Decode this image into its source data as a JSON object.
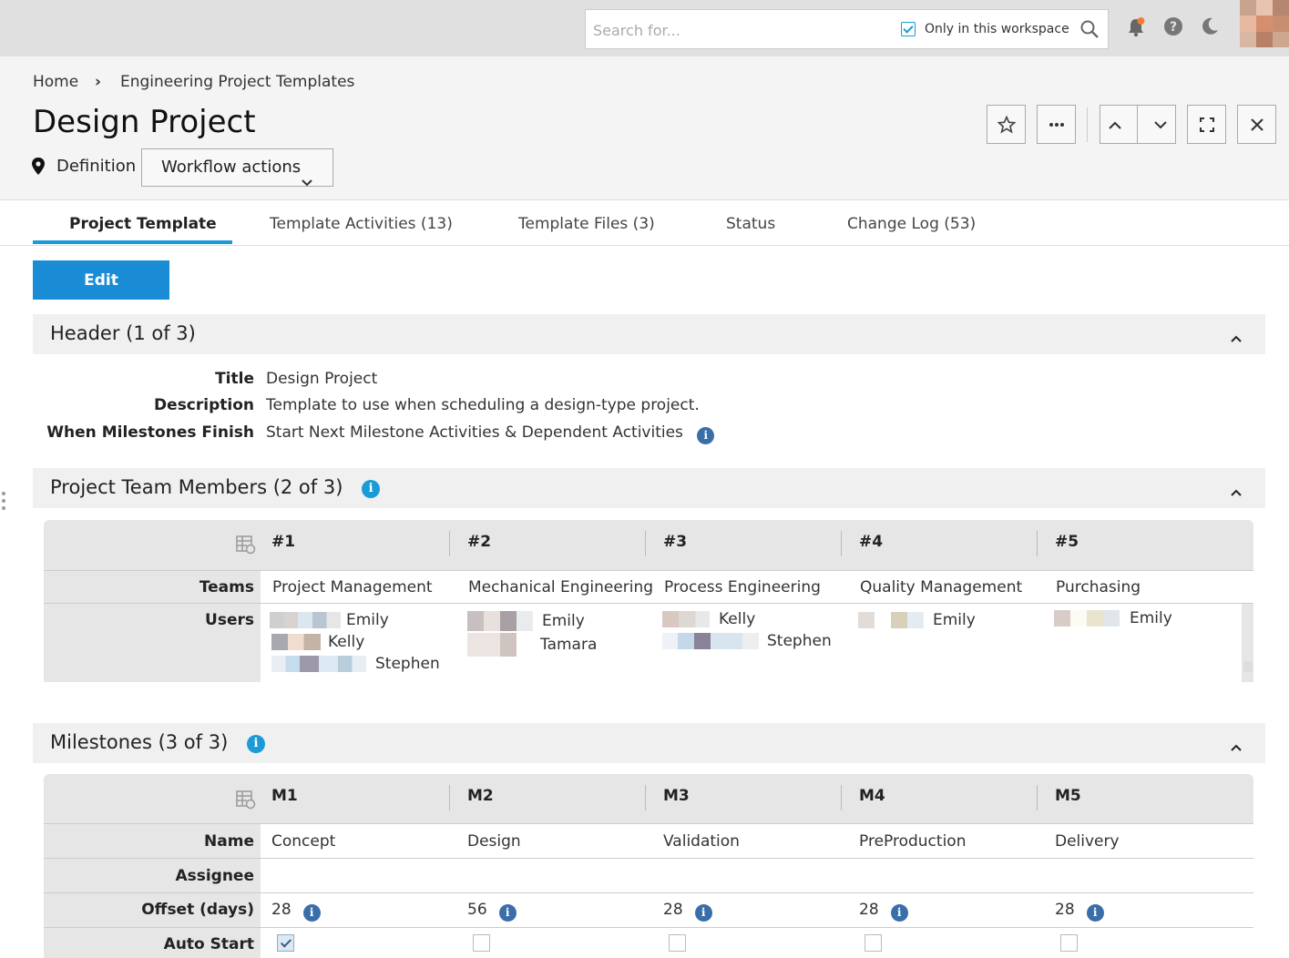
{
  "topbar": {
    "search_placeholder": "Search for...",
    "only_workspace_label": "Only in this workspace",
    "only_workspace_checked": true,
    "icons": [
      "search-icon",
      "notification-bell-icon",
      "help-icon",
      "dark-mode-moon-icon",
      "user-avatar"
    ]
  },
  "breadcrumb": {
    "home": "Home",
    "separator": "›",
    "current": "Engineering Project Templates"
  },
  "page": {
    "title": "Design Project",
    "state_label": "Definition",
    "workflow_actions_label": "Workflow actions"
  },
  "tabs": [
    {
      "label": "Project Template",
      "active": true
    },
    {
      "label": "Template Activities (13)"
    },
    {
      "label": "Template Files (3)"
    },
    {
      "label": "Status"
    },
    {
      "label": "Change Log (53)"
    }
  ],
  "edit_label": "Edit",
  "sections": {
    "header": {
      "title": "Header (1 of 3)",
      "fields": [
        {
          "label": "Title",
          "value": "Design Project"
        },
        {
          "label": "Description",
          "value": "Template to use when scheduling a design-type project."
        },
        {
          "label": "When Milestones Finish",
          "value": "Start Next Milestone Activities & Dependent Activities"
        }
      ]
    },
    "team": {
      "title": "Project Team Members (2 of 3)",
      "columns": [
        "#1",
        "#2",
        "#3",
        "#4",
        "#5"
      ],
      "row_labels": {
        "teams": "Teams",
        "users": "Users"
      },
      "teams": [
        "Project Management",
        "Mechanical Engineering",
        "Process Engineering",
        "Quality Management",
        "Purchasing"
      ],
      "users": [
        [
          "Emily",
          "Kelly",
          "Stephen"
        ],
        [
          "Emily",
          "Tamara"
        ],
        [
          "Kelly",
          "Stephen"
        ],
        [
          "Emily"
        ],
        [
          "Emily"
        ]
      ]
    },
    "milestones": {
      "title": "Milestones (3 of 3)",
      "columns": [
        "M1",
        "M2",
        "M3",
        "M4",
        "M5"
      ],
      "row_labels": {
        "name": "Name",
        "assignee": "Assignee",
        "offset": "Offset (days)",
        "auto_start": "Auto Start"
      },
      "names": [
        "Concept",
        "Design",
        "Validation",
        "PreProduction",
        "Delivery"
      ],
      "offsets": [
        "28",
        "56",
        "28",
        "28",
        "28"
      ],
      "auto_start": [
        true,
        false,
        false,
        false,
        false
      ]
    }
  },
  "colors": {
    "accent": "#1a9bd7",
    "edit_button": "#1a8cd6",
    "notification_dot": "#f47b3e"
  }
}
